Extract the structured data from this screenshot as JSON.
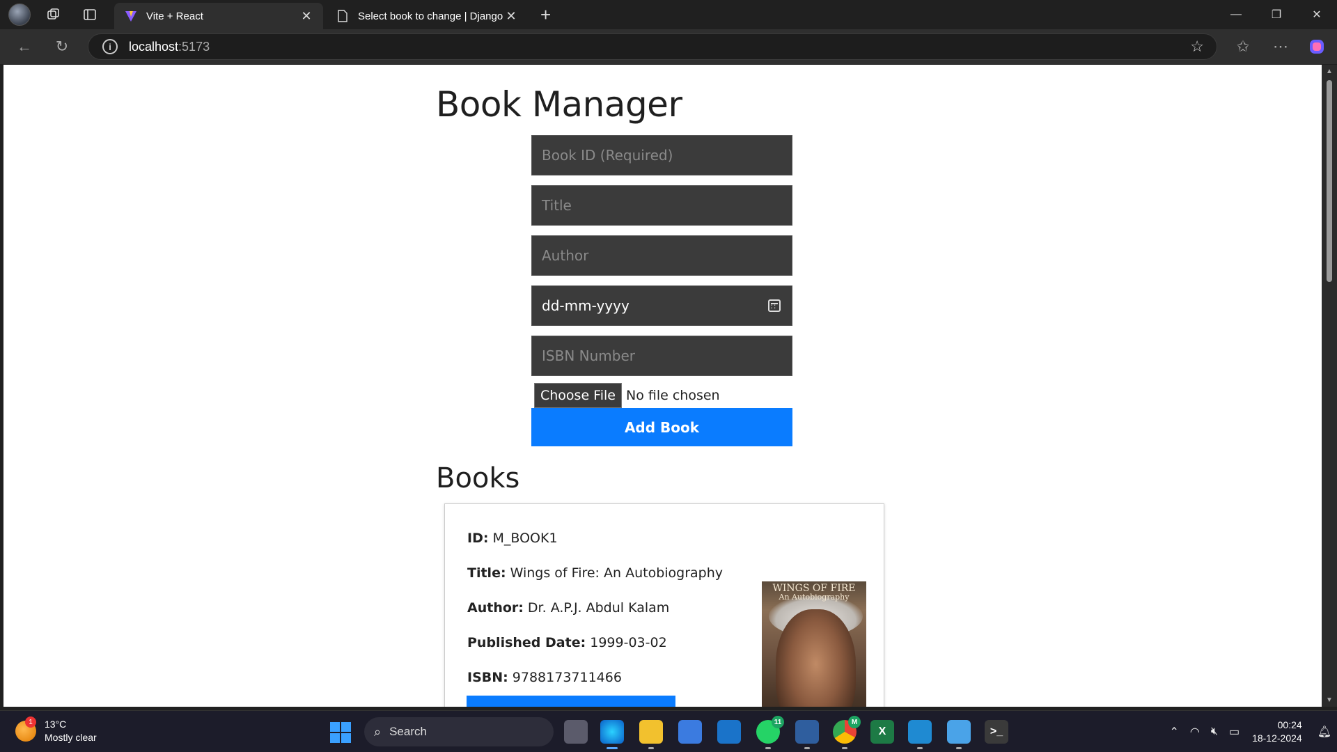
{
  "browser": {
    "tabs": [
      {
        "label": "Vite + React",
        "active": true
      },
      {
        "label": "Select book to change | Django si",
        "active": false
      }
    ],
    "new_tab": "+",
    "address": {
      "host": "localhost",
      "port": ":5173"
    },
    "window_controls": {
      "minimize": "—",
      "restore": "❐",
      "close": "✕"
    }
  },
  "page": {
    "title": "Book Manager",
    "form": {
      "book_id_placeholder": "Book ID (Required)",
      "title_placeholder": "Title",
      "author_placeholder": "Author",
      "date_placeholder": "dd-mm-yyyy",
      "isbn_placeholder": "ISBN Number",
      "file_button": "Choose File",
      "file_status": "No file chosen",
      "submit_label": "Add Book"
    },
    "books_heading": "Books",
    "books": [
      {
        "id_label": "ID:",
        "id": "M_BOOK1",
        "title_label": "Title:",
        "title": "Wings of Fire: An Autobiography",
        "author_label": "Author:",
        "author": "Dr. A.P.J. Abdul Kalam",
        "date_label": "Published Date:",
        "date": "1999-03-02",
        "isbn_label": "ISBN:",
        "isbn": "9788173711466",
        "cover_title": "WINGS OF FIRE",
        "cover_subtitle": "An Autobiography"
      }
    ]
  },
  "taskbar": {
    "weather": {
      "temp": "13°C",
      "condition": "Mostly clear",
      "badge": "1"
    },
    "search_label": "Search",
    "apps": [
      {
        "name": "file-manager",
        "label": ""
      },
      {
        "name": "edge",
        "label": ""
      },
      {
        "name": "explorer",
        "label": ""
      },
      {
        "name": "store",
        "label": ""
      },
      {
        "name": "outlook",
        "label": ""
      },
      {
        "name": "whatsapp",
        "label": "",
        "badge": "11"
      },
      {
        "name": "app-blue",
        "label": ""
      },
      {
        "name": "chrome",
        "label": "",
        "badge": "M"
      },
      {
        "name": "excel",
        "label": "X"
      },
      {
        "name": "vscode",
        "label": ""
      },
      {
        "name": "notepad",
        "label": ""
      },
      {
        "name": "terminal",
        "label": ">_"
      }
    ],
    "clock": {
      "time": "00:24",
      "date": "18-12-2024"
    }
  },
  "colors": {
    "accent": "#0a7cff",
    "input_bg": "#3b3b3b",
    "browser_chrome": "#202020"
  }
}
